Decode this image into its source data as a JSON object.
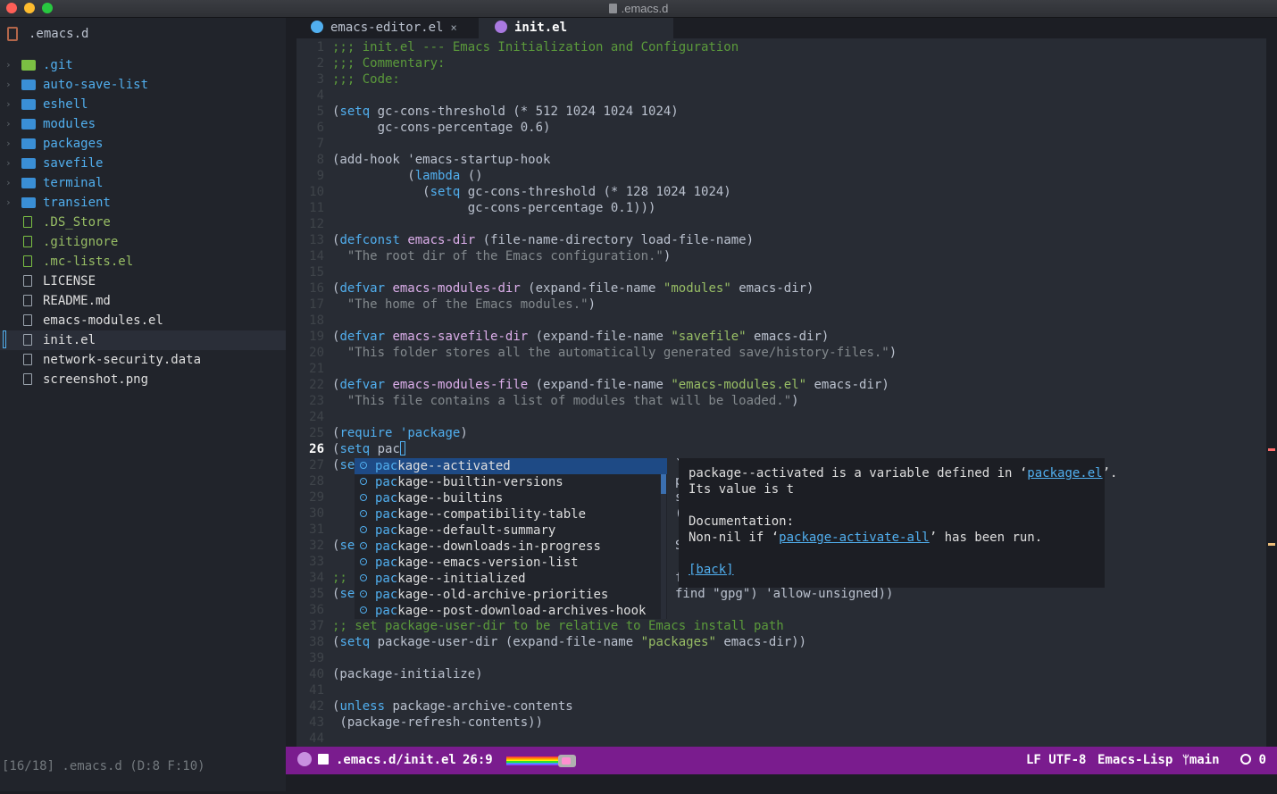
{
  "window": {
    "title": ".emacs.d"
  },
  "sidebar": {
    "project": ".emacs.d",
    "items": [
      {
        "label": ".git",
        "kind": "folder-green",
        "chevron": "›"
      },
      {
        "label": "auto-save-list",
        "kind": "folder",
        "chevron": "›"
      },
      {
        "label": "eshell",
        "kind": "folder",
        "chevron": "›"
      },
      {
        "label": "modules",
        "kind": "folder",
        "chevron": "›"
      },
      {
        "label": "packages",
        "kind": "folder",
        "chevron": "›"
      },
      {
        "label": "savefile",
        "kind": "folder",
        "chevron": "›"
      },
      {
        "label": "terminal",
        "kind": "folder",
        "chevron": "›"
      },
      {
        "label": "transient",
        "kind": "folder",
        "chevron": "›"
      },
      {
        "label": ".DS_Store",
        "kind": "file-green"
      },
      {
        "label": ".gitignore",
        "kind": "file-green"
      },
      {
        "label": ".mc-lists.el",
        "kind": "file-green"
      },
      {
        "label": "LICENSE",
        "kind": "file"
      },
      {
        "label": "README.md",
        "kind": "file"
      },
      {
        "label": "emacs-modules.el",
        "kind": "file"
      },
      {
        "label": "init.el",
        "kind": "file",
        "selected": true
      },
      {
        "label": "network-security.data",
        "kind": "file"
      },
      {
        "label": "screenshot.png",
        "kind": "image"
      }
    ],
    "status": "[16/18] .emacs.d (D:8 F:10)"
  },
  "tabs": [
    {
      "label": "emacs-editor.el",
      "close": "×"
    },
    {
      "label": "init.el"
    }
  ],
  "editor": {
    "current_line": 26,
    "lines": [
      {
        "n": "1",
        "parts": [
          {
            "t": ";;; init.el --- Emacs Initialization and Configuration",
            "c": "c-com"
          }
        ]
      },
      {
        "n": "2",
        "parts": [
          {
            "t": ";;; Commentary:",
            "c": "c-com"
          }
        ]
      },
      {
        "n": "3",
        "parts": [
          {
            "t": ";;; Code:",
            "c": "c-com"
          }
        ]
      },
      {
        "n": "4",
        "parts": []
      },
      {
        "n": "5",
        "parts": [
          {
            "t": "("
          },
          {
            "t": "setq",
            "c": "c-kw"
          },
          {
            "t": " gc-cons-threshold (* 512 1024 1024 1024)"
          }
        ]
      },
      {
        "n": "6",
        "parts": [
          {
            "t": "      gc-cons-percentage 0.6)"
          }
        ]
      },
      {
        "n": "7",
        "parts": []
      },
      {
        "n": "8",
        "parts": [
          {
            "t": "(add-hook 'emacs-startup-hook"
          }
        ]
      },
      {
        "n": "9",
        "parts": [
          {
            "t": "          ("
          },
          {
            "t": "lambda",
            "c": "c-kw"
          },
          {
            "t": " ()"
          }
        ]
      },
      {
        "n": "10",
        "parts": [
          {
            "t": "            ("
          },
          {
            "t": "setq",
            "c": "c-kw"
          },
          {
            "t": " gc-cons-threshold (* 128 1024 1024)"
          }
        ]
      },
      {
        "n": "11",
        "parts": [
          {
            "t": "                  gc-cons-percentage 0.1)))"
          }
        ]
      },
      {
        "n": "12",
        "parts": []
      },
      {
        "n": "13",
        "parts": [
          {
            "t": "("
          },
          {
            "t": "defconst",
            "c": "c-kw"
          },
          {
            "t": " "
          },
          {
            "t": "emacs-dir",
            "c": "c-var"
          },
          {
            "t": " (file-name-directory load-file-name)"
          }
        ]
      },
      {
        "n": "14",
        "parts": [
          {
            "t": "  \"The root dir of the Emacs configuration.\"",
            "c": "c-doc"
          },
          {
            "t": ")"
          }
        ]
      },
      {
        "n": "15",
        "parts": []
      },
      {
        "n": "16",
        "parts": [
          {
            "t": "("
          },
          {
            "t": "defvar",
            "c": "c-kw"
          },
          {
            "t": " "
          },
          {
            "t": "emacs-modules-dir",
            "c": "c-var"
          },
          {
            "t": " (expand-file-name "
          },
          {
            "t": "\"modules\"",
            "c": "c-str"
          },
          {
            "t": " emacs-dir)"
          }
        ]
      },
      {
        "n": "17",
        "parts": [
          {
            "t": "  \"The home of the Emacs modules.\"",
            "c": "c-doc"
          },
          {
            "t": ")"
          }
        ]
      },
      {
        "n": "18",
        "parts": []
      },
      {
        "n": "19",
        "parts": [
          {
            "t": "("
          },
          {
            "t": "defvar",
            "c": "c-kw"
          },
          {
            "t": " "
          },
          {
            "t": "emacs-savefile-dir",
            "c": "c-var"
          },
          {
            "t": " (expand-file-name "
          },
          {
            "t": "\"savefile\"",
            "c": "c-str"
          },
          {
            "t": " emacs-dir)"
          }
        ]
      },
      {
        "n": "20",
        "parts": [
          {
            "t": "  \"This folder stores all the automatically generated save/history-files.\"",
            "c": "c-doc"
          },
          {
            "t": ")"
          }
        ]
      },
      {
        "n": "21",
        "parts": []
      },
      {
        "n": "22",
        "parts": [
          {
            "t": "("
          },
          {
            "t": "defvar",
            "c": "c-kw"
          },
          {
            "t": " "
          },
          {
            "t": "emacs-modules-file",
            "c": "c-var"
          },
          {
            "t": " (expand-file-name "
          },
          {
            "t": "\"emacs-modules.el\"",
            "c": "c-str"
          },
          {
            "t": " emacs-dir)"
          }
        ]
      },
      {
        "n": "23",
        "parts": [
          {
            "t": "  \"This file contains a list of modules that will be loaded.\"",
            "c": "c-doc"
          },
          {
            "t": ")"
          }
        ]
      },
      {
        "n": "24",
        "parts": []
      },
      {
        "n": "25",
        "parts": [
          {
            "t": "("
          },
          {
            "t": "require",
            "c": "c-kw"
          },
          {
            "t": " "
          },
          {
            "t": "'package",
            "c": "c-kw"
          },
          {
            "t": ")"
          }
        ]
      },
      {
        "n": "26",
        "parts": [
          {
            "t": "("
          },
          {
            "t": "setq",
            "c": "c-kw"
          },
          {
            "t": " pac"
          }
        ],
        "cursor": true
      },
      {
        "n": "27",
        "parts": [
          {
            "t": "("
          },
          {
            "t": "se",
            "c": "c-kw"
          }
        ]
      },
      {
        "n": "28",
        "parts": []
      },
      {
        "n": "29",
        "parts": []
      },
      {
        "n": "30",
        "parts": []
      },
      {
        "n": "31",
        "parts": []
      },
      {
        "n": "32",
        "parts": [
          {
            "t": "("
          },
          {
            "t": "se",
            "c": "c-kw"
          }
        ]
      },
      {
        "n": "33",
        "parts": []
      },
      {
        "n": "34",
        "parts": [
          {
            "t": ";;",
            "c": "c-com"
          }
        ]
      },
      {
        "n": "35",
        "parts": [
          {
            "t": "("
          },
          {
            "t": "se",
            "c": "c-kw"
          }
        ]
      },
      {
        "n": "36",
        "parts": []
      },
      {
        "n": "37",
        "parts": [
          {
            "t": ";; set package-user-dir to be relative to Emacs install path",
            "c": "c-com"
          }
        ]
      },
      {
        "n": "38",
        "parts": [
          {
            "t": "("
          },
          {
            "t": "setq",
            "c": "c-kw"
          },
          {
            "t": " package-user-dir (expand-file-name "
          },
          {
            "t": "\"packages\"",
            "c": "c-str"
          },
          {
            "t": " emacs-dir))"
          }
        ]
      },
      {
        "n": "39",
        "parts": []
      },
      {
        "n": "40",
        "parts": [
          {
            "t": "(package-initialize)"
          }
        ]
      },
      {
        "n": "41",
        "parts": []
      },
      {
        "n": "42",
        "parts": [
          {
            "t": "("
          },
          {
            "t": "unless",
            "c": "c-kw"
          },
          {
            "t": " package-archive-contents"
          }
        ]
      },
      {
        "n": "43",
        "parts": [
          {
            "t": " (package-refresh-contents))"
          }
        ]
      },
      {
        "n": "44",
        "parts": []
      }
    ],
    "overflow_fragments": [
      {
        "line": "27",
        "text": "`"
      },
      {
        "line": "28",
        "text": "p"
      },
      {
        "line": "29",
        "text": "s"
      },
      {
        "line": "30",
        "text": "("
      },
      {
        "line": "32",
        "text": "S"
      },
      {
        "line": "34",
        "text": "f"
      },
      {
        "line": "35",
        "text": "find \"gpg\") 'allow-unsigned))"
      }
    ]
  },
  "completion": {
    "prefix": "pac",
    "items": [
      "package--activated",
      "package--builtin-versions",
      "package--builtins",
      "package--compatibility-table",
      "package--default-summary",
      "package--downloads-in-progress",
      "package--emacs-version-list",
      "package--initialized",
      "package--old-archive-priorities",
      "package--post-download-archives-hook"
    ],
    "active_index": 0
  },
  "doc_popup": {
    "line1_a": "package--activated is a variable defined in ‘",
    "line1_link": "package.el",
    "line1_b": "’.",
    "line2": "Its value is t",
    "line3": "Documentation:",
    "line4_a": "Non-nil if ‘",
    "line4_link": "package-activate-all",
    "line4_b": "’ has been run.",
    "back": "[back]"
  },
  "modeline": {
    "path": ".emacs.d/init.el",
    "position": "26:9",
    "eol_encoding": "LF UTF-8",
    "major_mode": "Emacs-Lisp",
    "branch": "main",
    "errors": "0"
  },
  "colors": {
    "modeline_bg": "#7a1c8e",
    "accent": "#51afef",
    "editor_bg": "#282c34",
    "sidebar_bg": "#21242b"
  }
}
